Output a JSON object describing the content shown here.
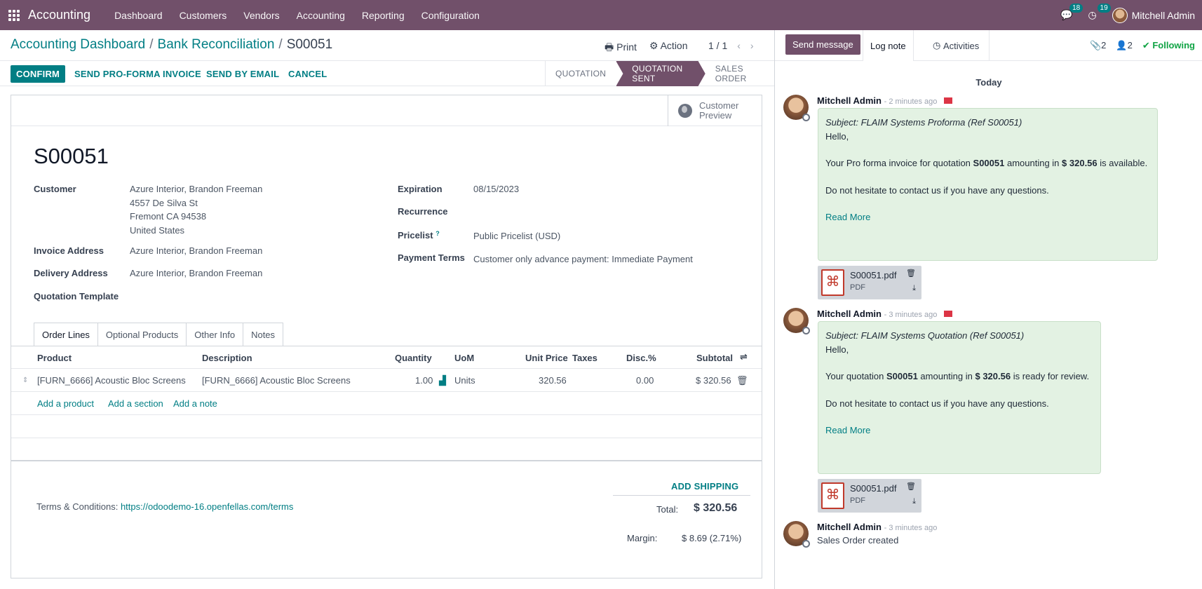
{
  "topbar": {
    "app_name": "Accounting",
    "menu": [
      "Dashboard",
      "Customers",
      "Vendors",
      "Accounting",
      "Reporting",
      "Configuration"
    ],
    "messages_count": "18",
    "activities_count": "19",
    "user_name": "Mitchell Admin"
  },
  "breadcrumb": {
    "item1": "Accounting Dashboard",
    "item2": "Bank Reconciliation",
    "current": "S00051",
    "sep": "/"
  },
  "control": {
    "print_label": "Print",
    "action_label": "Action",
    "pager": "1 / 1",
    "prev": "‹",
    "next": "›"
  },
  "buttons": {
    "confirm": "CONFIRM",
    "proforma": "SEND PRO-FORMA INVOICE",
    "email": "SEND BY EMAIL",
    "cancel": "CANCEL"
  },
  "statusbar": [
    "QUOTATION",
    "QUOTATION SENT",
    "SALES ORDER"
  ],
  "statusbar_active": "QUOTATION SENT",
  "form": {
    "customer_preview": "Customer Preview",
    "name": "S00051",
    "customer_label": "Customer",
    "customer_lines": [
      "Azure Interior, Brandon Freeman",
      "4557 De Silva St",
      "Fremont CA 94538",
      "United States"
    ],
    "invoice_address_label": "Invoice Address",
    "invoice_address": "Azure Interior, Brandon Freeman",
    "delivery_address_label": "Delivery Address",
    "delivery_address": "Azure Interior, Brandon Freeman",
    "quotation_template_label": "Quotation Template",
    "expiration_label": "Expiration",
    "expiration": "08/15/2023",
    "recurrence_label": "Recurrence",
    "pricelist_label": "Pricelist",
    "pricelist_help": "?",
    "pricelist": "Public Pricelist (USD)",
    "payment_terms_label": "Payment Terms",
    "payment_terms": "Customer only advance payment: Immediate Payment"
  },
  "tabs": [
    "Order Lines",
    "Optional Products",
    "Other Info",
    "Notes"
  ],
  "lines": {
    "headers": [
      "Product",
      "Description",
      "Quantity",
      "UoM",
      "Unit Price",
      "Taxes",
      "Disc.%",
      "Subtotal"
    ],
    "rows": [
      {
        "product": "[FURN_6666] Acoustic Bloc Screens",
        "description": "[FURN_6666] Acoustic Bloc Screens",
        "quantity": "1.00",
        "uom": "Units",
        "unit_price": "320.56",
        "taxes": "",
        "discount": "0.00",
        "subtotal": "$ 320.56"
      }
    ],
    "add_product": "Add a product",
    "add_section": "Add a section",
    "add_note": "Add a note"
  },
  "footer": {
    "terms_label": "Terms & Conditions:",
    "terms_link": "https://odoodemo-16.openfellas.com/terms",
    "add_shipping": "ADD SHIPPING",
    "total_label": "Total:",
    "total": "$ 320.56",
    "margin_label": "Margin:",
    "margin": "$ 8.69 (2.71%)"
  },
  "chatter": {
    "send_message": "Send message",
    "log_note": "Log note",
    "activities": "Activities",
    "attachments_count": "2",
    "followers_count": "2",
    "following": "Following",
    "today": "Today",
    "messages": [
      {
        "author": "Mitchell Admin",
        "ago": "- 2 minutes ago",
        "subject": "Subject: FLAIM Systems Proforma (Ref S00051)",
        "hello": "Hello,",
        "body_pre": "Your Pro forma invoice for quotation ",
        "body_ref": "S00051",
        "body_mid": " amounting in ",
        "body_amt": "$ 320.56",
        "body_post": " is available.",
        "closing": "Do not hesitate to contact us if you have any questions.",
        "read_more": "Read More",
        "attachment": {
          "name": "S00051.pdf",
          "type": "PDF"
        }
      },
      {
        "author": "Mitchell Admin",
        "ago": "- 3 minutes ago",
        "subject": "Subject: FLAIM Systems Quotation (Ref S00051)",
        "hello": "Hello,",
        "body_pre": "Your quotation ",
        "body_ref": "S00051",
        "body_mid": " amounting in ",
        "body_amt": "$ 320.56",
        "body_post": " is ready for review.",
        "closing": "Do not hesitate to contact us if you have any questions.",
        "read_more": "Read More",
        "attachment": {
          "name": "S00051.pdf",
          "type": "PDF"
        }
      },
      {
        "author": "Mitchell Admin",
        "ago": "- 3 minutes ago",
        "text": "Sales Order created"
      }
    ]
  },
  "colors": {
    "brand": "#71506a",
    "accent": "#017e84",
    "note_bg": "#e3f2e3"
  }
}
